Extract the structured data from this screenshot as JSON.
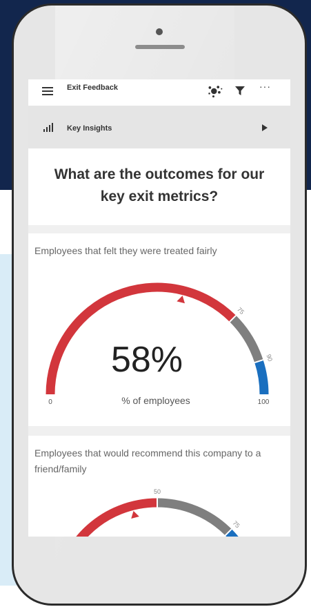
{
  "app": {
    "title": "Exit Feedback",
    "icons": [
      "menu-icon",
      "cluster-icon",
      "filter-icon",
      "more-icon"
    ]
  },
  "section": {
    "label": "Key Insights",
    "expand_icon": "play-icon"
  },
  "headline": "What are the outcomes for our key exit metrics?",
  "colors": {
    "red": "#d2363c",
    "gray": "#7f7f7f",
    "blue": "#1a6fbf",
    "phone_frame": "#2b2b2b",
    "background": "#12264d"
  },
  "gauges": [
    {
      "title": "Employees that felt they were treated fairly",
      "value_label": "58%",
      "subtitle": "% of employees",
      "min_label": "0",
      "max_label": "100",
      "value": 58,
      "min": 0,
      "max": 100,
      "bands": [
        {
          "from": 0,
          "to": 75,
          "color": "#d2363c",
          "label": "75"
        },
        {
          "from": 75,
          "to": 90,
          "color": "#7f7f7f",
          "label": "90"
        },
        {
          "from": 90,
          "to": 100,
          "color": "#1a6fbf",
          "label": ""
        }
      ]
    },
    {
      "title": "Employees that would recommend this company to a friend/family",
      "min": 0,
      "max": 100,
      "value": 42,
      "bands": [
        {
          "from": 0,
          "to": 50,
          "color": "#d2363c",
          "label": "50"
        },
        {
          "from": 50,
          "to": 75,
          "color": "#7f7f7f",
          "label": "75"
        },
        {
          "from": 75,
          "to": 100,
          "color": "#1a6fbf",
          "label": ""
        }
      ]
    }
  ]
}
